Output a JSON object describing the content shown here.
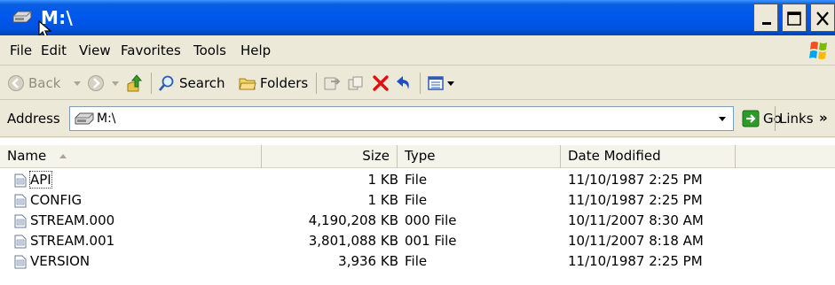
{
  "window": {
    "title": "M:\\",
    "title_icon": "drive-icon",
    "caption_buttons": [
      "minimize-icon",
      "maximize-icon",
      "close-icon"
    ]
  },
  "menu": {
    "items": [
      "File",
      "Edit",
      "View",
      "Favorites",
      "Tools",
      "Help"
    ]
  },
  "toolbar": {
    "back_label": "Back",
    "search_label": "Search",
    "folders_label": "Folders"
  },
  "address": {
    "label": "Address",
    "value": "M:\\",
    "go_label": "Go",
    "links_label": "Links",
    "links_chevron": "»"
  },
  "list": {
    "columns": [
      "Name",
      "Size",
      "Type",
      "Date Modified"
    ],
    "rows": [
      {
        "name": "API",
        "size": "1 KB",
        "type": "File",
        "date": "11/10/1987 2:25 PM"
      },
      {
        "name": "CONFIG",
        "size": "1 KB",
        "type": "File",
        "date": "11/10/1987 2:25 PM"
      },
      {
        "name": "STREAM.000",
        "size": "4,190,208 KB",
        "type": "000 File",
        "date": "10/11/2007 8:30 AM"
      },
      {
        "name": "STREAM.001",
        "size": "3,801,088 KB",
        "type": "001 File",
        "date": "10/11/2007 8:18 AM"
      },
      {
        "name": "VERSION",
        "size": "3,936 KB",
        "type": "File",
        "date": "11/10/1987 2:25 PM"
      }
    ],
    "focused_row": "API",
    "sort_column": "Name"
  },
  "colors": {
    "titlebar": "#0058ee",
    "chrome": "#ece9d8",
    "close_x": "#ff0000",
    "up_arrow": "#3a9a2a",
    "go_arrow": "#2e9a2a"
  }
}
